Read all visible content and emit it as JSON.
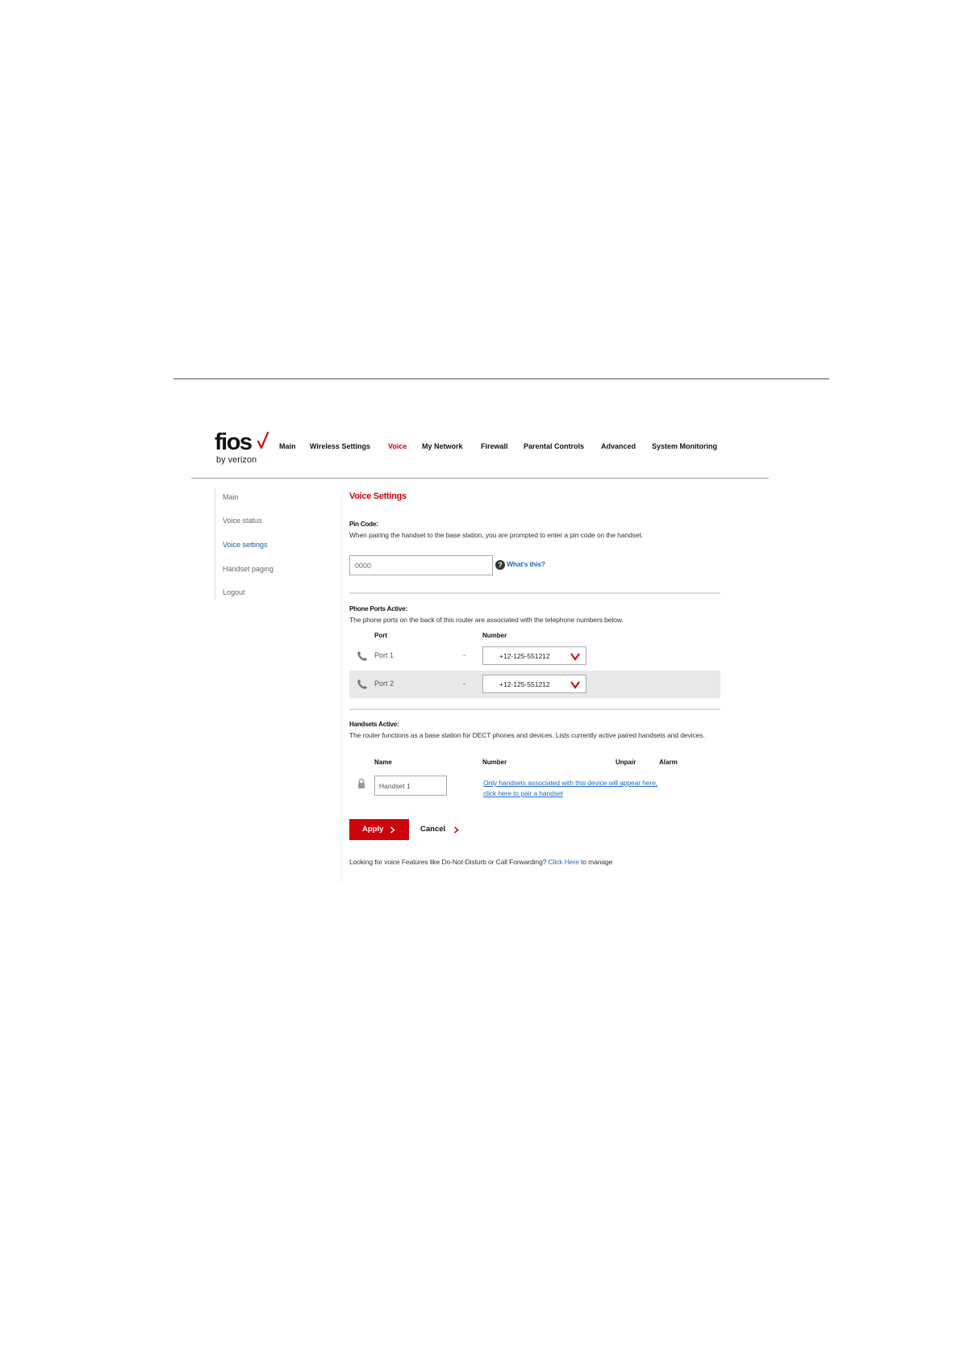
{
  "brand": {
    "logo_word": "fios",
    "logo_sub": "by verizon",
    "accent": "#cd040b",
    "link_color": "#1b6ac9"
  },
  "topnav": {
    "items": [
      {
        "label": "Main"
      },
      {
        "label": "Wireless Settings"
      },
      {
        "label": "Voice",
        "active": true
      },
      {
        "label": "My Network"
      },
      {
        "label": "Firewall"
      },
      {
        "label": "Parental Controls"
      },
      {
        "label": "Advanced"
      },
      {
        "label": "System Monitoring"
      }
    ]
  },
  "sidebar": {
    "items": [
      {
        "label": "Main"
      },
      {
        "label": "Voice status"
      },
      {
        "label": "Voice settings",
        "active": true
      },
      {
        "label": "Handset paging"
      },
      {
        "label": "Logout"
      }
    ]
  },
  "page": {
    "title": "Voice Settings"
  },
  "pin": {
    "heading": "Pin Code:",
    "desc": "When pairing the handset to the base station, you are prompted to enter a pin code on the handset.",
    "value": "0000",
    "help_icon": "question-circle-icon",
    "help_label": "What's this?"
  },
  "ports": {
    "heading": "Phone Ports Active:",
    "desc": "The phone ports on the back of this router are associated with the telephone numbers below.",
    "col_port": "Port",
    "col_number": "Number",
    "rows": [
      {
        "port": "Port 1",
        "dash": "-",
        "number": "+12-125-551212"
      },
      {
        "port": "Port 2",
        "dash": "-",
        "number": "+12-125-551212"
      }
    ]
  },
  "handsets": {
    "heading": "Handsets Active:",
    "desc": "The router functions as a base station for DECT phones and devices. Lists currently active paired handsets and devices.",
    "col_name": "Name",
    "col_number": "Number",
    "col_unpair": "Unpair",
    "col_alarm": "Alarm",
    "rows": [
      {
        "name": "Handset 1"
      }
    ],
    "link_line1": "Only handsets associated with this device will appear here,",
    "link_line2": "click here to pair a handset"
  },
  "actions": {
    "apply": "Apply",
    "cancel": "Cancel"
  },
  "footer": {
    "before": "Looking for voice Features like Do-Not-Disturb or Call Forwarding? ",
    "link": "Click Here",
    "after": " to manage"
  }
}
